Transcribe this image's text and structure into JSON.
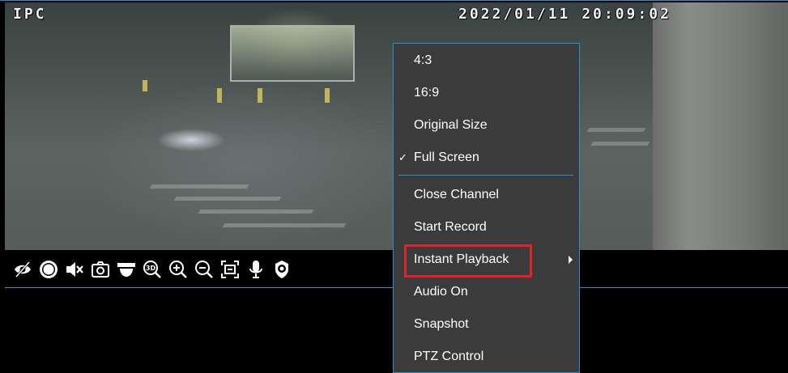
{
  "video": {
    "osd_name": "IPC",
    "osd_datetime": "2022/01/11  20:09:02"
  },
  "toolbar": {
    "icons": [
      "hide-icon",
      "record-icon",
      "mute-icon",
      "snapshot-icon",
      "dome-camera-icon",
      "3d-zoom-icon",
      "zoom-in-icon",
      "zoom-out-icon",
      "fit-screen-icon",
      "microphone-icon",
      "ptz-icon"
    ]
  },
  "context_menu": {
    "items": [
      {
        "label": "4:3"
      },
      {
        "label": "16:9"
      },
      {
        "label": "Original Size"
      },
      {
        "label": "Full Screen",
        "checked": true
      },
      {
        "label": "Close Channel"
      },
      {
        "label": "Start Record"
      },
      {
        "label": "Instant Playback",
        "has_submenu": true,
        "highlighted": true
      },
      {
        "label": "Audio On"
      },
      {
        "label": "Snapshot"
      },
      {
        "label": "PTZ Control"
      }
    ],
    "check_mark": "✓"
  },
  "colors": {
    "accent": "#2a8fd0",
    "menu_bg": "#3b3b3b",
    "highlight": "#e0222a"
  }
}
